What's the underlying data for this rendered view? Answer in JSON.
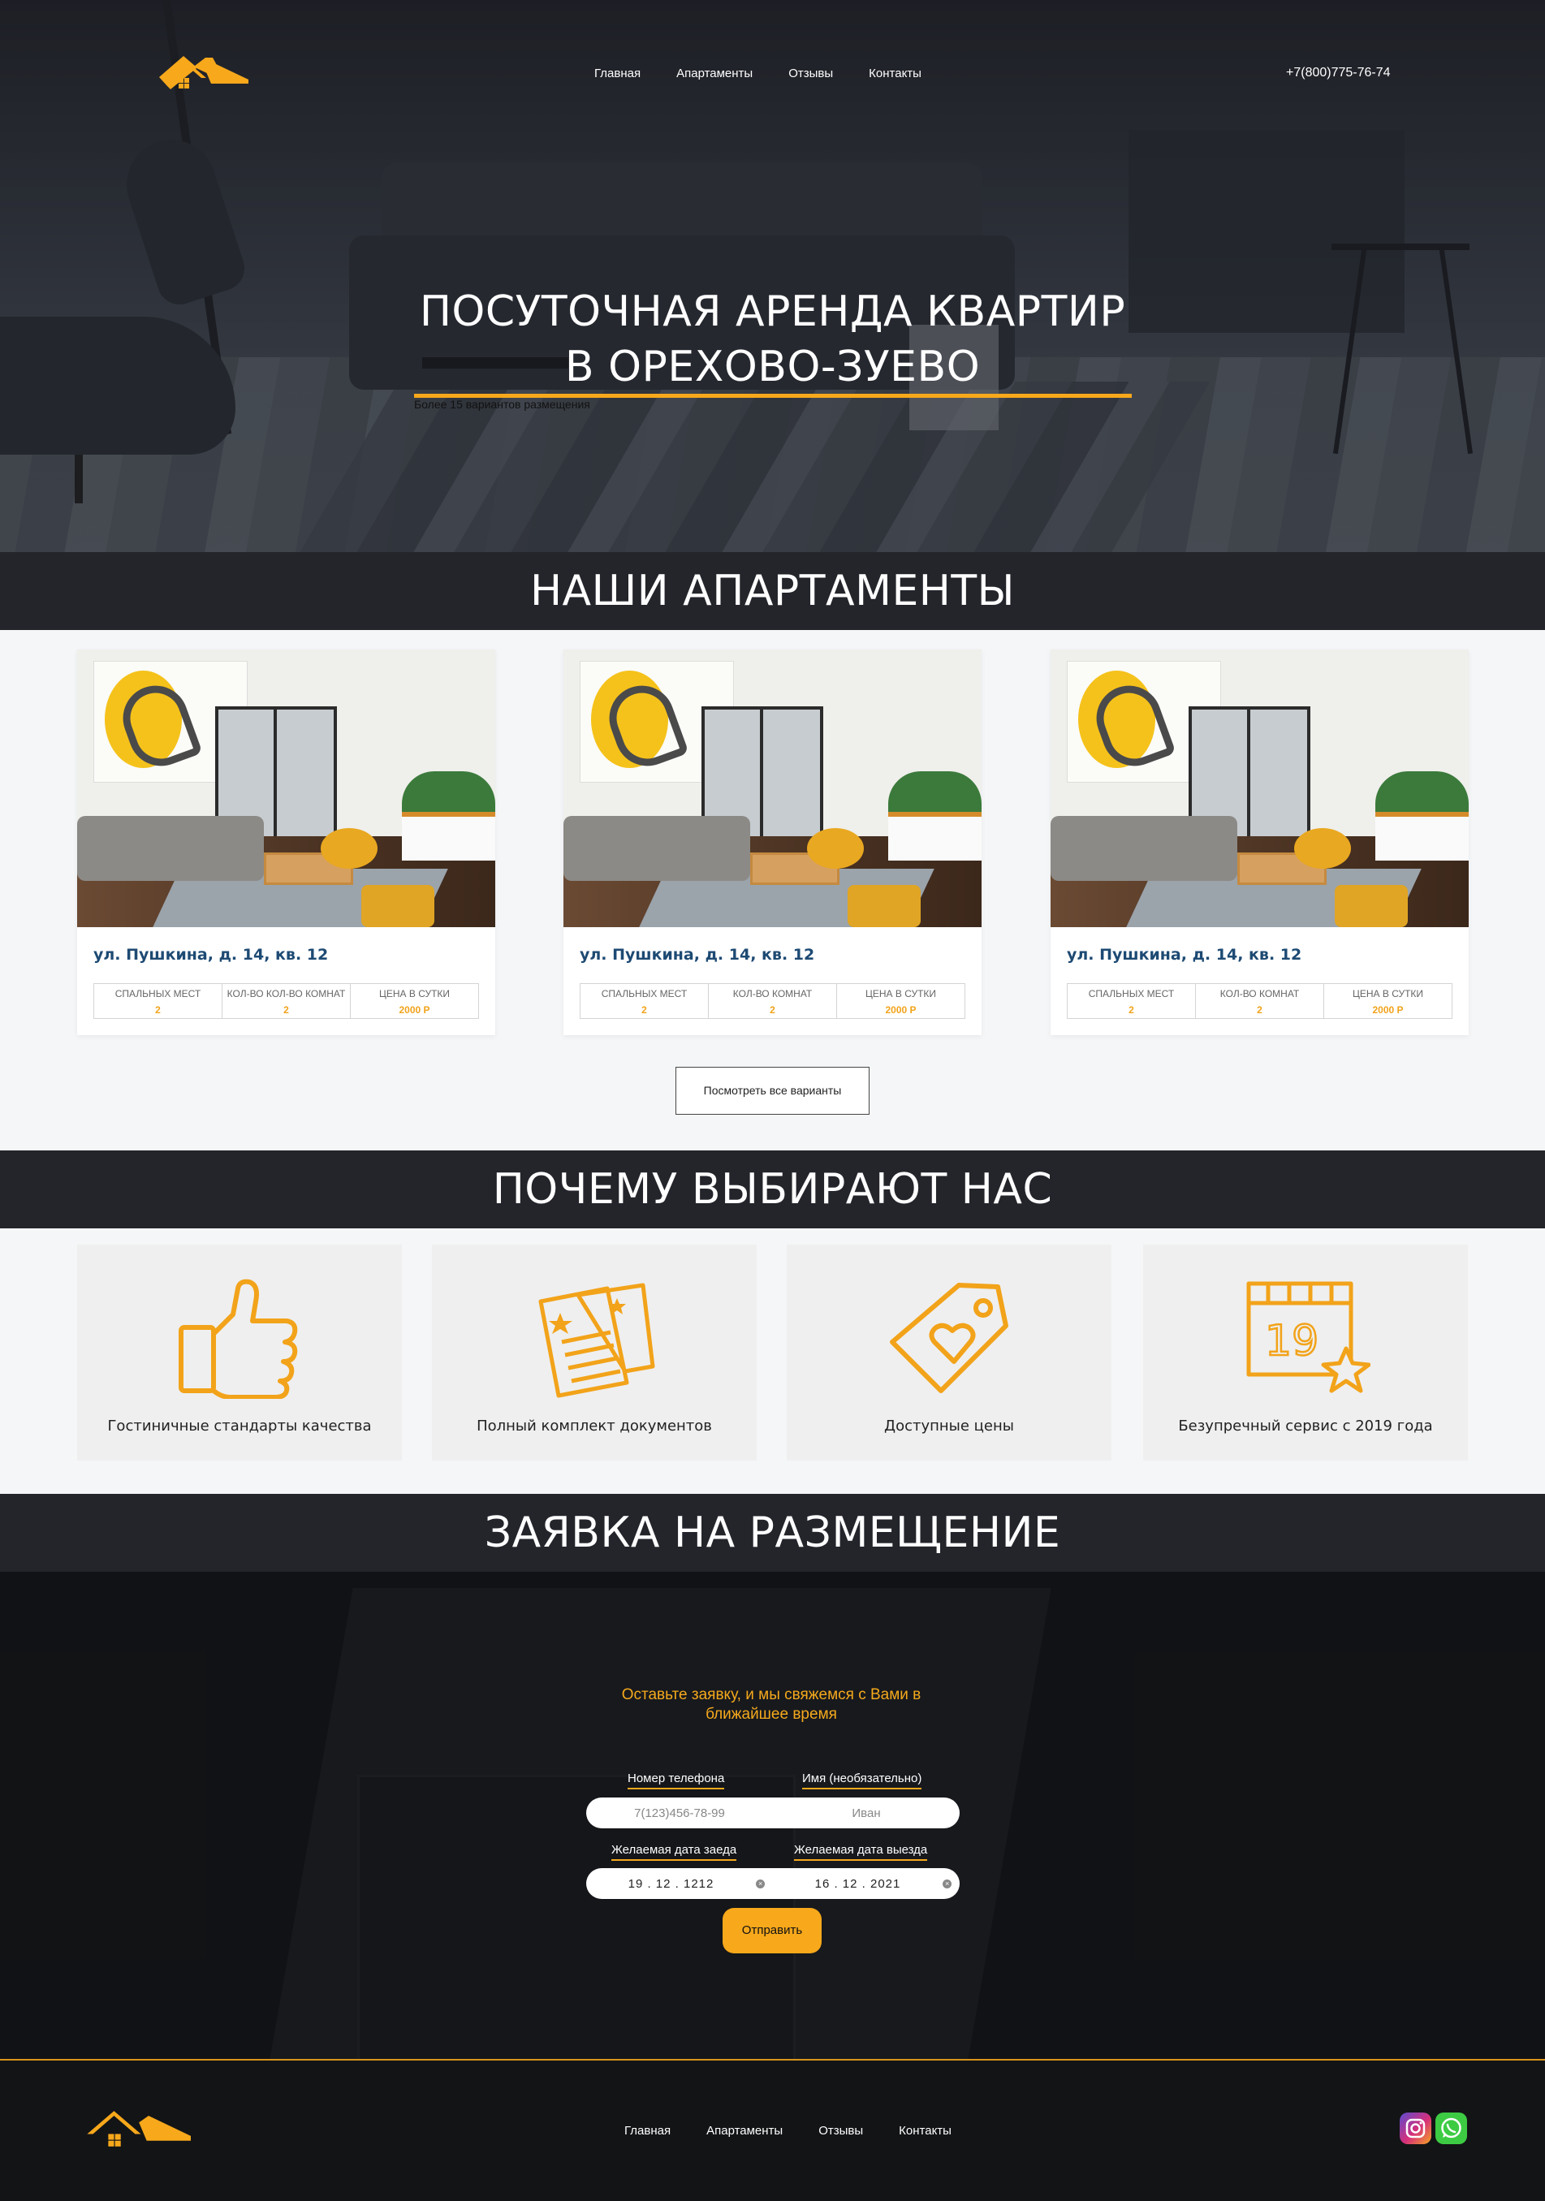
{
  "header": {
    "nav": [
      "Главная",
      "Апартаменты",
      "Отзывы",
      "Контакты"
    ],
    "phone": "+7(800)775-76-74"
  },
  "hero": {
    "title_line1": "ПОСУТОЧНАЯ АРЕНДА КВАРТИР",
    "title_line2": "В ОРЕХОВО-ЗУЕВО",
    "subtitle": "Более 15 вариантов размещения"
  },
  "apartments": {
    "heading": "НАШИ АПАРТАМЕНТЫ",
    "cards": [
      {
        "address": "ул. Пушкина, д. 14, кв. 12",
        "beds_label": "СПАЛЬНЫХ МЕСТ",
        "beds": "2",
        "rooms_label": "КОЛ-ВО КОЛ-ВО КОМНАТ",
        "rooms": "2",
        "price_label": "ЦЕНА В СУТКИ",
        "price": "2000 Р"
      },
      {
        "address": "ул. Пушкина, д. 14, кв. 12",
        "beds_label": "СПАЛЬНЫХ МЕСТ",
        "beds": "2",
        "rooms_label": "КОЛ-ВО КОМНАТ",
        "rooms": "2",
        "price_label": "ЦЕНА В СУТКИ",
        "price": "2000 Р"
      },
      {
        "address": "ул. Пушкина, д. 14, кв. 12",
        "beds_label": "СПАЛЬНЫХ МЕСТ",
        "beds": "2",
        "rooms_label": "КОЛ-ВО КОМНАТ",
        "rooms": "2",
        "price_label": "ЦЕНА В СУТКИ",
        "price": "2000 Р"
      }
    ],
    "view_all": "Посмотреть все варианты"
  },
  "why": {
    "heading": "ПОЧЕМУ ВЫБИРАЮТ НАС",
    "items": [
      {
        "label": "Гостиничные стандарты качества",
        "icon": "thumbs-up-icon"
      },
      {
        "label": "Полный комплект документов",
        "icon": "documents-icon"
      },
      {
        "label": "Доступные цены",
        "icon": "price-tag-heart-icon"
      },
      {
        "label": "Безупречный сервис с 2019 года",
        "icon": "calendar-star-icon",
        "calendar_day": "19"
      }
    ]
  },
  "form": {
    "heading": "ЗАЯВКА НА РАЗМЕЩЕНИЕ",
    "intro": "Оставьте заявку, и мы свяжемся с Вами в ближайшее время",
    "phone_label": "Номер телефона",
    "phone_placeholder": "7(123)456-78-99",
    "name_label": "Имя (необязательно)",
    "name_placeholder": "Иван",
    "checkin_label": "Желаемая дата заеда",
    "checkin_value": "19 . 12 . 1212",
    "checkout_label": "Желаемая дата выезда",
    "checkout_value": "16 . 12 . 2021",
    "submit": "Отправить"
  },
  "footer": {
    "nav": [
      "Главная",
      "Апартаменты",
      "Отзывы",
      "Контакты"
    ],
    "social": [
      "instagram-icon",
      "whatsapp-icon"
    ]
  },
  "colors": {
    "accent": "#f7a81b",
    "dark": "#23252b",
    "link": "#1d4a73"
  }
}
